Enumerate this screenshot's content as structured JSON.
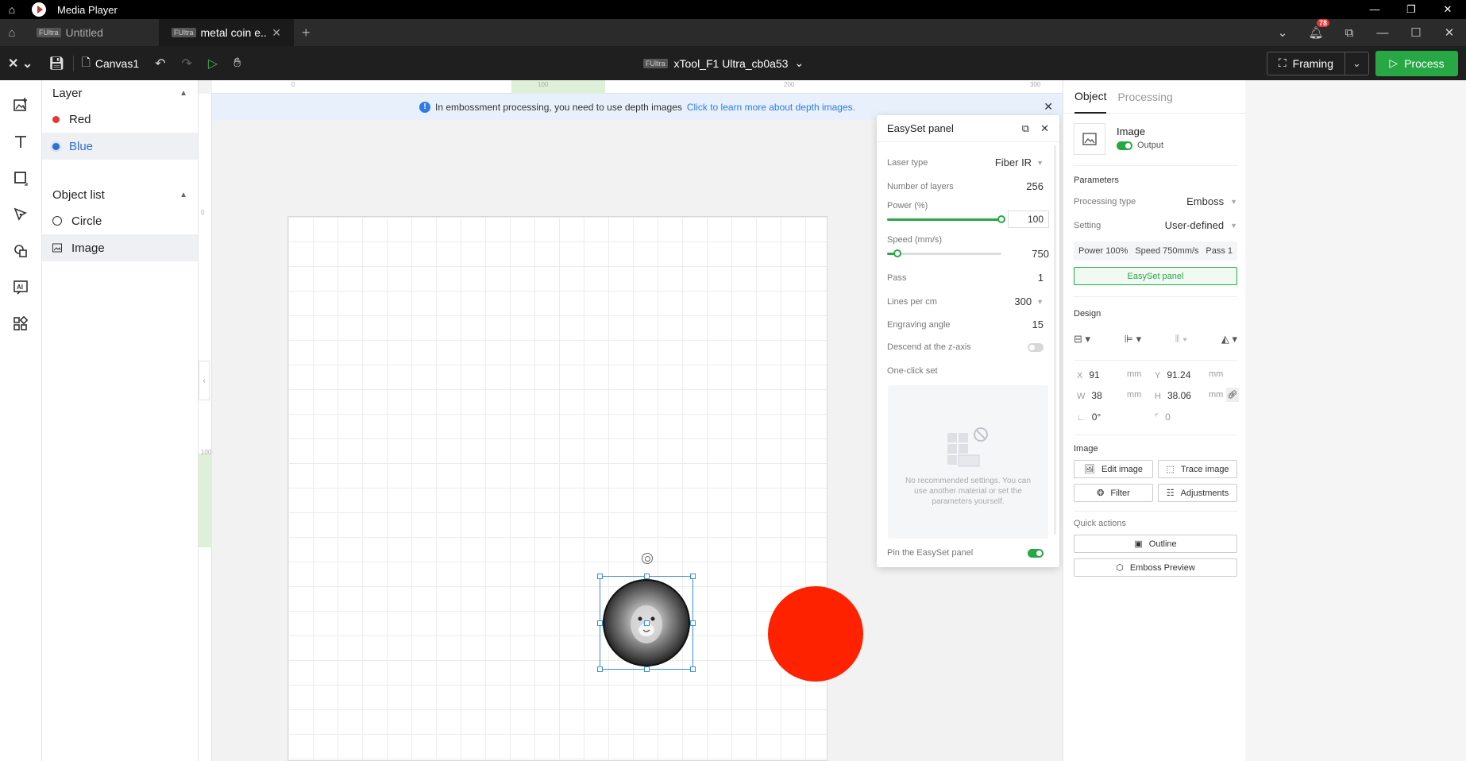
{
  "os": {
    "title": "Media Player"
  },
  "tabs": [
    {
      "badge": "FUltra",
      "label": "Untitled"
    },
    {
      "badge": "FUltra",
      "label": "metal coin e..."
    }
  ],
  "notifications": {
    "count": "78"
  },
  "toolbar": {
    "canvas_label": "Canvas1",
    "device_badge": "FUltra",
    "device_name": "xTool_F1 Ultra_cb0a53",
    "framing_label": "Framing",
    "process_label": "Process"
  },
  "layer_panel": {
    "title": "Layer",
    "layers": [
      {
        "label": "Red",
        "color": "#e53935"
      },
      {
        "label": "Blue",
        "color": "#2f6fd6"
      }
    ]
  },
  "object_list": {
    "title": "Object list",
    "items": [
      {
        "label": "Circle",
        "icon": "circle-outline-icon"
      },
      {
        "label": "Image",
        "icon": "image-icon"
      }
    ]
  },
  "rulers": {
    "top_ticks": [
      "0",
      "100",
      "200",
      "300"
    ],
    "left_ticks": [
      "0",
      "100"
    ]
  },
  "info_bar": {
    "message": "In embossment processing, you need to use depth images",
    "link": "Click to learn more about depth images."
  },
  "easyset": {
    "title": "EasySet panel",
    "laser_type_label": "Laser type",
    "laser_type_value": "Fiber IR",
    "layers_label": "Number of layers",
    "layers_value": "256",
    "power_label": "Power (%)",
    "power_value": "100",
    "power_fraction": 1.0,
    "speed_label": "Speed (mm/s)",
    "speed_value": "750",
    "speed_fraction": 0.09,
    "pass_label": "Pass",
    "pass_value": "1",
    "lines_label": "Lines per cm",
    "lines_value": "300",
    "angle_label": "Engraving angle",
    "angle_value": "15",
    "descend_label": "Descend at the z-axis",
    "oneclick_label": "One-click set",
    "empty_text": "No recommended settings. You can use another material or set the parameters yourself.",
    "pin_label": "Pin the EasySet panel"
  },
  "right_panel": {
    "tabs": [
      "Object",
      "Processing"
    ],
    "image_title": "Image",
    "output_label": "Output",
    "parameters_title": "Parameters",
    "processing_type_label": "Processing type",
    "processing_type_value": "Emboss",
    "setting_label": "Setting",
    "setting_value": "User-defined",
    "summary_power": "Power 100%",
    "summary_speed": "Speed 750mm/s",
    "summary_pass": "Pass 1",
    "easyset_button": "EasySet panel",
    "design_title": "Design",
    "x_label": "X",
    "x_value": "91",
    "x_unit": "mm",
    "y_label": "Y",
    "y_value": "91.24",
    "y_unit": "mm",
    "w_label": "W",
    "w_value": "38",
    "w_unit": "mm",
    "h_label": "H",
    "h_value": "38.06",
    "h_unit": "mm",
    "rotation_value": "0°",
    "corner_value": "0",
    "image_section_title": "Image",
    "edit_image": "Edit image",
    "trace_image": "Trace image",
    "filter": "Filter",
    "adjustments": "Adjustments",
    "quick_actions_title": "Quick actions",
    "outline": "Outline",
    "emboss_preview": "Emboss Preview"
  },
  "colors": {
    "accent": "#27a844",
    "link": "#2f7be5",
    "red_object": "#ff2200"
  }
}
